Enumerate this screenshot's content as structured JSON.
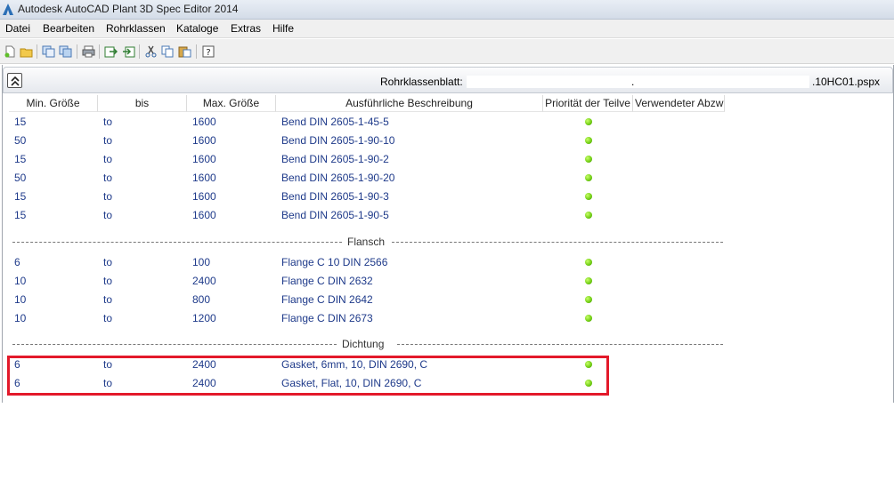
{
  "window": {
    "title": "Autodesk AutoCAD Plant 3D Spec Editor 2014"
  },
  "menu": [
    "Datei",
    "Bearbeiten",
    "Rohrklassen",
    "Kataloge",
    "Extras",
    "Hilfe"
  ],
  "toolbar": [
    "new-icon",
    "open-icon",
    "copy-sheet-icon",
    "paste-sheet-icon",
    "print-icon",
    "export-icon",
    "import-icon",
    "cut-icon",
    "copy-icon",
    "paste-icon",
    "help-icon"
  ],
  "spec": {
    "label": "Rohrklassenblatt:",
    "value_dot": ".",
    "value": ".10HC01.pspx"
  },
  "columns": [
    "Min. Größe",
    "bis",
    "Max. Größe",
    "Ausführliche Beschreibung",
    "Priorität der Teilve",
    "Verwendeter Abzw"
  ],
  "groups": [
    {
      "name": "",
      "rows": [
        {
          "min": "15",
          "bis": "to",
          "max": "1600",
          "desc": "Bend DIN 2605-1-45-5"
        },
        {
          "min": "50",
          "bis": "to",
          "max": "1600",
          "desc": "Bend DIN 2605-1-90-10"
        },
        {
          "min": "15",
          "bis": "to",
          "max": "1600",
          "desc": "Bend DIN 2605-1-90-2"
        },
        {
          "min": "50",
          "bis": "to",
          "max": "1600",
          "desc": "Bend DIN 2605-1-90-20"
        },
        {
          "min": "15",
          "bis": "to",
          "max": "1600",
          "desc": "Bend DIN 2605-1-90-3"
        },
        {
          "min": "15",
          "bis": "to",
          "max": "1600",
          "desc": "Bend DIN 2605-1-90-5"
        }
      ]
    },
    {
      "name": "Flansch",
      "rows": [
        {
          "min": "6",
          "bis": "to",
          "max": "100",
          "desc": "Flange C 10 DIN 2566"
        },
        {
          "min": "10",
          "bis": "to",
          "max": "2400",
          "desc": "Flange C DIN 2632"
        },
        {
          "min": "10",
          "bis": "to",
          "max": "800",
          "desc": "Flange C DIN 2642"
        },
        {
          "min": "10",
          "bis": "to",
          "max": "1200",
          "desc": "Flange C DIN 2673"
        }
      ]
    },
    {
      "name": "Dichtung",
      "rows": [
        {
          "min": "6",
          "bis": "to",
          "max": "2400",
          "desc": "Gasket, 6mm, 10, DIN 2690, C"
        },
        {
          "min": "6",
          "bis": "to",
          "max": "2400",
          "desc": "Gasket, Flat, 10, DIN 2690, C"
        }
      ]
    }
  ],
  "colors": {
    "cell_text": "#1e3a8a",
    "priority_dot": "#6fcc12",
    "highlight": "#e3192a"
  }
}
